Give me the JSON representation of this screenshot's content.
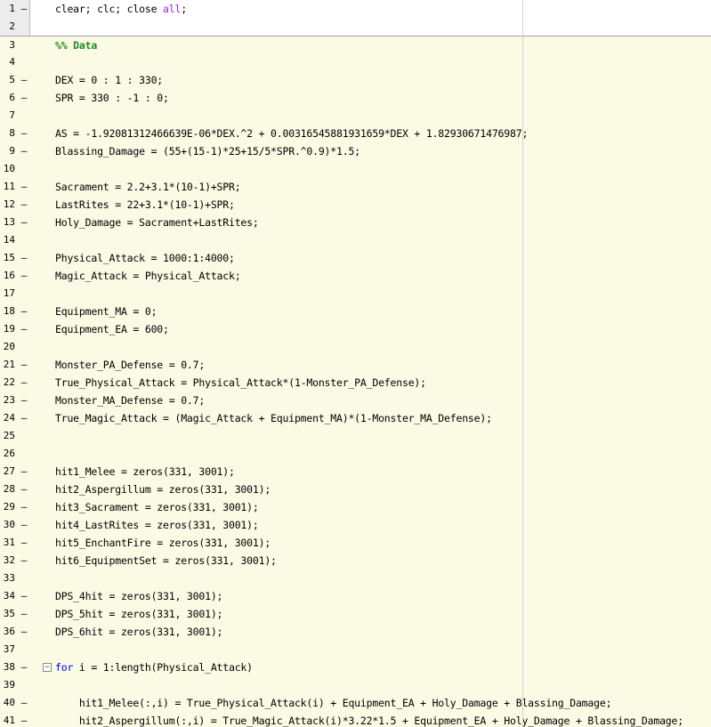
{
  "colors": {
    "cell_highlight": "#fafae5",
    "keyword": "#0000ff",
    "string": "#a020f0",
    "comment": "#228b22",
    "gutter": "#ececec"
  },
  "lines": [
    {
      "num": "1",
      "mark": "–",
      "cell": false,
      "tokens": [
        {
          "t": "clear; clc; close ",
          "c": "plain"
        },
        {
          "t": "all",
          "c": "str"
        },
        {
          "t": ";",
          "c": "plain"
        }
      ]
    },
    {
      "num": "2",
      "mark": "",
      "cell": false,
      "tokens": []
    },
    {
      "num": "3",
      "mark": "",
      "cell": true,
      "cellstart": true,
      "tokens": [
        {
          "t": "%% Data",
          "c": "cmt"
        }
      ]
    },
    {
      "num": "4",
      "mark": "",
      "cell": true,
      "tokens": []
    },
    {
      "num": "5",
      "mark": "–",
      "cell": true,
      "tokens": [
        {
          "t": "DEX = 0 : 1 : 330;",
          "c": "plain"
        }
      ]
    },
    {
      "num": "6",
      "mark": "–",
      "cell": true,
      "tokens": [
        {
          "t": "SPR = 330 : -1 : 0;",
          "c": "plain"
        }
      ]
    },
    {
      "num": "7",
      "mark": "",
      "cell": true,
      "tokens": []
    },
    {
      "num": "8",
      "mark": "–",
      "cell": true,
      "tokens": [
        {
          "t": "AS = -1.92081312466639E-06*DEX.^2 + 0.00316545881931659*DEX + 1.82930671476987;",
          "c": "plain"
        }
      ]
    },
    {
      "num": "9",
      "mark": "–",
      "cell": true,
      "tokens": [
        {
          "t": "Blassing_Damage = (55+(15-1)*25+15/5*SPR.^0.9)*1.5;",
          "c": "plain"
        }
      ]
    },
    {
      "num": "10",
      "mark": "",
      "cell": true,
      "tokens": []
    },
    {
      "num": "11",
      "mark": "–",
      "cell": true,
      "tokens": [
        {
          "t": "Sacrament = 2.2+3.1*(10-1)+SPR;",
          "c": "plain"
        }
      ]
    },
    {
      "num": "12",
      "mark": "–",
      "cell": true,
      "tokens": [
        {
          "t": "LastRites = 22+3.1*(10-1)+SPR;",
          "c": "plain"
        }
      ]
    },
    {
      "num": "13",
      "mark": "–",
      "cell": true,
      "tokens": [
        {
          "t": "Holy_Damage = Sacrament+LastRites;",
          "c": "plain"
        }
      ]
    },
    {
      "num": "14",
      "mark": "",
      "cell": true,
      "tokens": []
    },
    {
      "num": "15",
      "mark": "–",
      "cell": true,
      "tokens": [
        {
          "t": "Physical_Attack = 1000:1:4000;",
          "c": "plain"
        }
      ]
    },
    {
      "num": "16",
      "mark": "–",
      "cell": true,
      "tokens": [
        {
          "t": "Magic_Attack = Physical_Attack;",
          "c": "plain"
        }
      ]
    },
    {
      "num": "17",
      "mark": "",
      "cell": true,
      "tokens": []
    },
    {
      "num": "18",
      "mark": "–",
      "cell": true,
      "tokens": [
        {
          "t": "Equipment_MA = 0;",
          "c": "plain"
        }
      ]
    },
    {
      "num": "19",
      "mark": "–",
      "cell": true,
      "tokens": [
        {
          "t": "Equipment_EA = 600;",
          "c": "plain"
        }
      ]
    },
    {
      "num": "20",
      "mark": "",
      "cell": true,
      "tokens": []
    },
    {
      "num": "21",
      "mark": "–",
      "cell": true,
      "tokens": [
        {
          "t": "Monster_PA_Defense = 0.7;",
          "c": "plain"
        }
      ]
    },
    {
      "num": "22",
      "mark": "–",
      "cell": true,
      "tokens": [
        {
          "t": "True_Physical_Attack = Physical_Attack*(1-Monster_PA_Defense);",
          "c": "plain"
        }
      ]
    },
    {
      "num": "23",
      "mark": "–",
      "cell": true,
      "tokens": [
        {
          "t": "Monster_MA_Defense = 0.7;",
          "c": "plain"
        }
      ]
    },
    {
      "num": "24",
      "mark": "–",
      "cell": true,
      "tokens": [
        {
          "t": "True_Magic_Attack = (Magic_Attack + Equipment_MA)*(1-Monster_MA_Defense);",
          "c": "plain"
        }
      ]
    },
    {
      "num": "25",
      "mark": "",
      "cell": true,
      "tokens": []
    },
    {
      "num": "26",
      "mark": "",
      "cell": true,
      "tokens": []
    },
    {
      "num": "27",
      "mark": "–",
      "cell": true,
      "tokens": [
        {
          "t": "hit1_Melee = zeros(331, 3001);",
          "c": "plain"
        }
      ]
    },
    {
      "num": "28",
      "mark": "–",
      "cell": true,
      "tokens": [
        {
          "t": "hit2_Aspergillum = zeros(331, 3001);",
          "c": "plain"
        }
      ]
    },
    {
      "num": "29",
      "mark": "–",
      "cell": true,
      "tokens": [
        {
          "t": "hit3_Sacrament = zeros(331, 3001);",
          "c": "plain"
        }
      ]
    },
    {
      "num": "30",
      "mark": "–",
      "cell": true,
      "tokens": [
        {
          "t": "hit4_LastRites = zeros(331, 3001);",
          "c": "plain"
        }
      ]
    },
    {
      "num": "31",
      "mark": "–",
      "cell": true,
      "tokens": [
        {
          "t": "hit5_EnchantFire = zeros(331, 3001);",
          "c": "plain"
        }
      ]
    },
    {
      "num": "32",
      "mark": "–",
      "cell": true,
      "tokens": [
        {
          "t": "hit6_EquipmentSet = zeros(331, 3001);",
          "c": "plain"
        }
      ]
    },
    {
      "num": "33",
      "mark": "",
      "cell": true,
      "tokens": []
    },
    {
      "num": "34",
      "mark": "–",
      "cell": true,
      "tokens": [
        {
          "t": "DPS_4hit = zeros(331, 3001);",
          "c": "plain"
        }
      ]
    },
    {
      "num": "35",
      "mark": "–",
      "cell": true,
      "tokens": [
        {
          "t": "DPS_5hit = zeros(331, 3001);",
          "c": "plain"
        }
      ]
    },
    {
      "num": "36",
      "mark": "–",
      "cell": true,
      "tokens": [
        {
          "t": "DPS_6hit = zeros(331, 3001);",
          "c": "plain"
        }
      ]
    },
    {
      "num": "37",
      "mark": "",
      "cell": true,
      "tokens": []
    },
    {
      "num": "38",
      "mark": "–",
      "cell": true,
      "fold": "−",
      "tokens": [
        {
          "t": "for",
          "c": "kw"
        },
        {
          "t": " i = 1:length(Physical_Attack)",
          "c": "plain"
        }
      ]
    },
    {
      "num": "39",
      "mark": "",
      "cell": true,
      "tokens": []
    },
    {
      "num": "40",
      "mark": "–",
      "cell": true,
      "tokens": [
        {
          "t": "    hit1_Melee(:,i) = True_Physical_Attack(i) + Equipment_EA + Holy_Damage + Blassing_Damage;",
          "c": "plain"
        }
      ]
    },
    {
      "num": "41",
      "mark": "–",
      "cell": true,
      "tokens": [
        {
          "t": "    hit2_Aspergillum(:,i) = True_Magic_Attack(i)*3.22*1.5 + Equipment_EA + Holy_Damage + Blassing_Damage;",
          "c": "plain"
        }
      ]
    }
  ]
}
